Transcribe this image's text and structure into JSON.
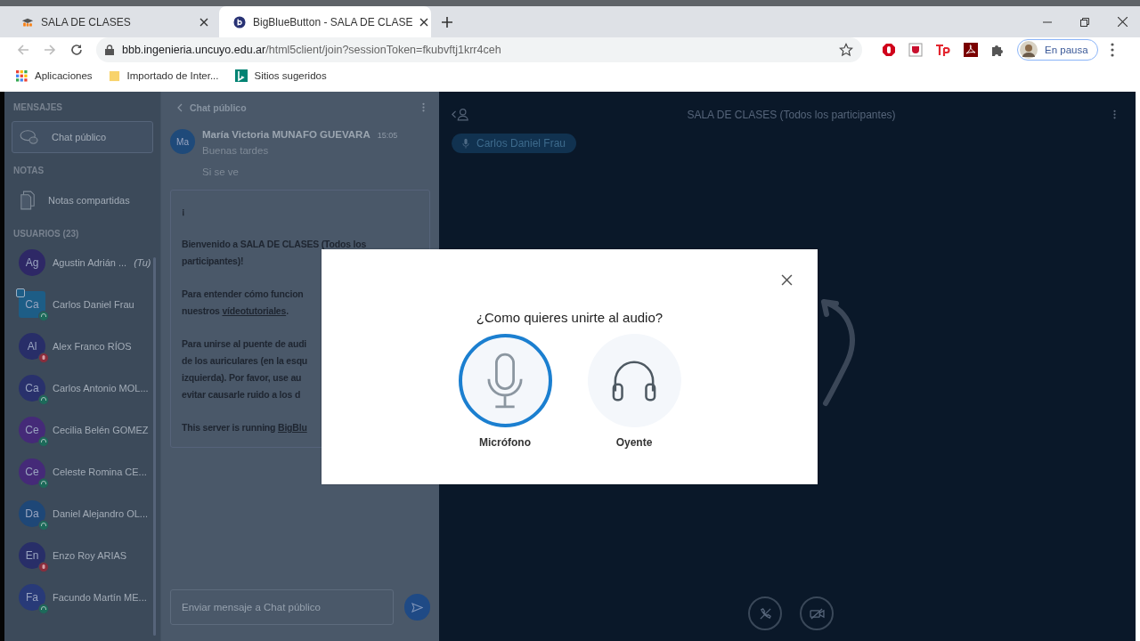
{
  "browser": {
    "tabs": [
      {
        "title": "SALA DE CLASES",
        "kind": "moodle",
        "selected": false
      },
      {
        "title": "BigBlueButton - SALA DE CLASE",
        "kind": "bbb",
        "selected": true
      }
    ],
    "url": {
      "host": "bbb.ingenieria.uncuyo.edu.ar",
      "path": "/html5client/join?sessionToken=fkubvftj1krr4ceh"
    },
    "profile": {
      "label": "En pausa"
    },
    "bookmarks": [
      {
        "label": "Aplicaciones",
        "kind": "apps"
      },
      {
        "label": "Importado de Inter...",
        "kind": "folder"
      },
      {
        "label": "Sitios sugeridos",
        "kind": "bing"
      }
    ]
  },
  "sidebar": {
    "messages_heading": "MENSAJES",
    "public_chat": {
      "label": "Chat público",
      "selected": true
    },
    "notes_heading": "NOTAS",
    "notes": {
      "label": "Notas compartidas"
    },
    "users_heading": "USUARIOS (23)",
    "users": [
      {
        "initials": "Ag",
        "name": "Agustin Adrián ...",
        "you_label": "(Tu)",
        "kind": "round",
        "in_audio": false,
        "muted": false,
        "color": "#2e2866"
      },
      {
        "initials": "Ca",
        "name": "Carlos Daniel Frau",
        "kind": "presenter",
        "in_audio": true,
        "muted": false,
        "color": "#1d5d86"
      },
      {
        "initials": "Al",
        "name": "Alex Franco RÍOS",
        "kind": "round",
        "in_audio": true,
        "muted": true,
        "color": "#282e68"
      },
      {
        "initials": "Ca",
        "name": "Carlos Antonio MOL...",
        "kind": "round",
        "in_audio": true,
        "muted": false,
        "color": "#29316c"
      },
      {
        "initials": "Ce",
        "name": "Cecilia Belén GOMEZ",
        "kind": "round",
        "in_audio": true,
        "muted": false,
        "color": "#452a78"
      },
      {
        "initials": "Ce",
        "name": "Celeste Romina CE...",
        "kind": "round",
        "in_audio": true,
        "muted": false,
        "color": "#452a78"
      },
      {
        "initials": "Da",
        "name": "Daniel Alejandro OL...",
        "kind": "round",
        "in_audio": true,
        "muted": false,
        "color": "#1e4777"
      },
      {
        "initials": "En",
        "name": "Enzo Roy ARIAS",
        "kind": "round",
        "in_audio": true,
        "muted": true,
        "color": "#282e68"
      },
      {
        "initials": "Fa",
        "name": "Facundo Martín ME...",
        "kind": "round",
        "in_audio": true,
        "muted": false,
        "color": "#283a78"
      }
    ]
  },
  "chat": {
    "title": "Chat público",
    "messages": [
      {
        "initials": "Ma",
        "author": "María Victoria MUNAFO GUEVARA",
        "time": "15:05",
        "lines": [
          "Buenas tardes",
          "Si se ve"
        ]
      }
    ],
    "welcome": [
      [
        "¡"
      ],
      [
        "Bienvenido a SALA DE CLASES (Todos los",
        "participantes)!"
      ],
      [
        "Para entender cómo funcion",
        "nuestros **vídeotutoriales**."
      ],
      [
        "Para unirse al puente de audi",
        "de los auriculares (en la esqu",
        "izquierda). Por favor, use au",
        "evitar causarle ruido a los d"
      ],
      [
        "This server is running **BigBlu**"
      ]
    ],
    "input": {
      "placeholder": "Enviar mensaje a Chat público"
    }
  },
  "main": {
    "title": "SALA DE CLASES (Todos los participantes)",
    "talker": "Carlos Daniel Frau"
  },
  "audio_modal": {
    "title": "¿Como quieres unirte al audio?",
    "options": [
      {
        "label": "Micrófono",
        "kind": "microphone",
        "selected": true
      },
      {
        "label": "Oyente",
        "kind": "listen",
        "selected": false
      }
    ]
  }
}
